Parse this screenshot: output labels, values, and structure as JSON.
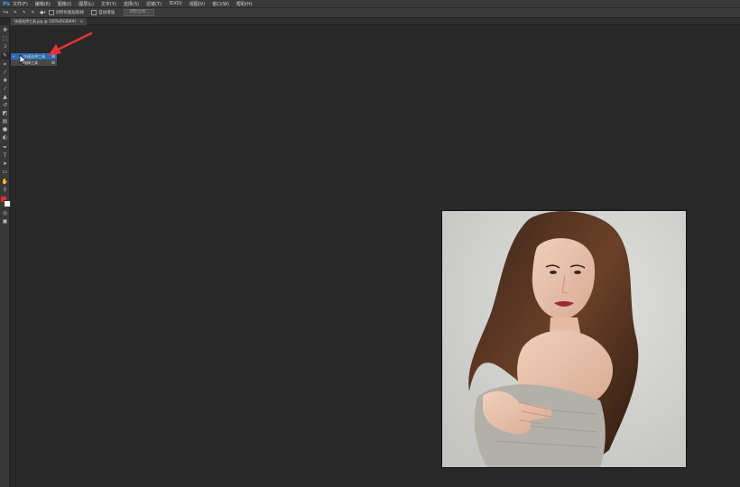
{
  "app": {
    "logo": "Ps"
  },
  "menu": {
    "items": [
      "文件(F)",
      "编辑(E)",
      "图像(I)",
      "图层(L)",
      "文字(Y)",
      "选择(S)",
      "滤镜(T)",
      "3D(D)",
      "视图(V)",
      "窗口(W)",
      "帮助(H)"
    ]
  },
  "options": {
    "sample_all_layers": "对所有图层取样",
    "auto_enhance": "自动增强",
    "refine_edge": "调整边缘..."
  },
  "document": {
    "tab_title": "快速选择工具.jpg @ 100%(RGB/8#)",
    "tab_close": "×"
  },
  "flyout": {
    "items": [
      {
        "label": "快速选择工具",
        "key": "W",
        "selected": true
      },
      {
        "label": "魔棒工具",
        "key": "W",
        "selected": false
      }
    ]
  },
  "colors": {
    "accent": "#2b6bb0",
    "arrow": "#e53333",
    "foreground": "#e5322d",
    "background": "#ffffff"
  },
  "icons": [
    "move-icon",
    "marquee-icon",
    "lasso-icon",
    "quick-select-icon",
    "crop-icon",
    "eyedropper-icon",
    "healing-icon",
    "brush-icon",
    "stamp-icon",
    "history-brush-icon",
    "eraser-icon",
    "gradient-icon",
    "blur-icon",
    "dodge-icon",
    "pen-icon",
    "type-icon",
    "path-select-icon",
    "shape-icon",
    "hand-icon",
    "zoom-icon"
  ]
}
